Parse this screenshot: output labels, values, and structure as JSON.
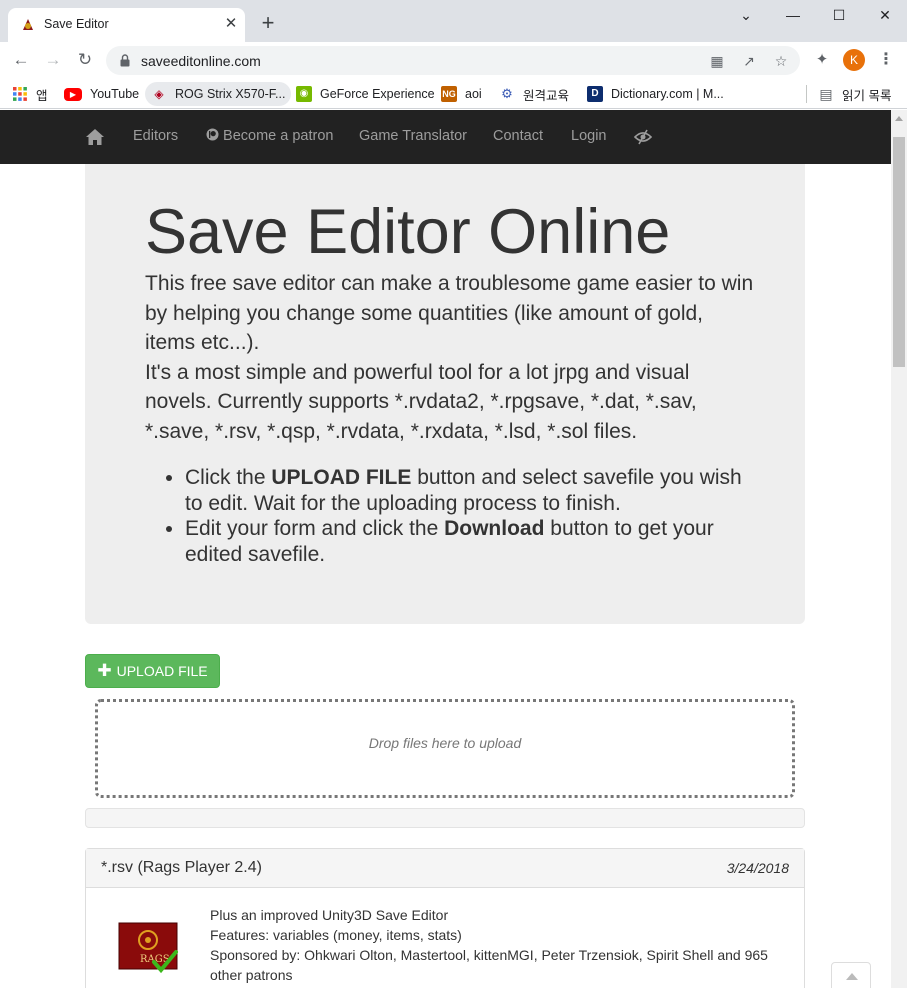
{
  "browser": {
    "tab_title": "Save Editor",
    "tab_close": "✕",
    "new_tab": "+",
    "window_controls": [
      "⌄",
      "—",
      "☐",
      "✕"
    ],
    "url": "saveeditonline.com",
    "avatar_letter": "K",
    "bookmarks": [
      {
        "label": "앱",
        "icon": "apps-grid-icon"
      },
      {
        "label": "YouTube",
        "icon": "youtube-icon",
        "color": "#ff0000"
      },
      {
        "label": "ROG Strix X570-F...",
        "icon": "rog-icon",
        "color": "#b0001e"
      },
      {
        "label": "GeForce Experience",
        "icon": "nvidia-icon",
        "color": "#76b900"
      },
      {
        "label": "aoi",
        "icon": "ng-icon",
        "color": "#c06000"
      },
      {
        "label": "원격교육",
        "icon": "globe-icon",
        "color": "#3b5bb5"
      },
      {
        "label": "Dictionary.com | M...",
        "icon": "dictionary-icon",
        "color": "#0d2d6e"
      },
      {
        "label": "읽기 목록",
        "icon": "reading-list-icon"
      }
    ]
  },
  "nav": {
    "links": [
      "Editors",
      "Become a patron",
      "Game Translator",
      "Contact",
      "Login"
    ]
  },
  "hero": {
    "title": "Save Editor Online",
    "intro_line1": "This free save editor can make a troublesome game easier to win by helping you change some quantities (like amount of gold, items etc...).",
    "intro_line2": "It's a most simple and powerful tool for a lot jrpg and visual novels. Currently supports *.rvdata2, *.rpgsave, *.dat, *.sav, *.save, *.rsv, *.qsp, *.rvdata, *.rxdata, *.lsd, *.sol files.",
    "steps": [
      {
        "before": "Click the ",
        "bold": "UPLOAD FILE",
        "after": " button and select savefile you wish to edit. Wait for the uploading process to finish."
      },
      {
        "before": "Edit your form and click the ",
        "bold": "Download",
        "after": " button to get your edited savefile."
      }
    ]
  },
  "upload": {
    "button_label": "UPLOAD FILE",
    "drop_text": "Drop files here to upload"
  },
  "entry": {
    "title": "*.rsv (Rags Player 2.4)",
    "date": "3/24/2018",
    "line1": "Plus an improved Unity3D Save Editor",
    "line2": "Features: variables (money, items, stats)",
    "line3": "Sponsored by: Ohkwari Olton, Mastertool, kittenMGI, Peter Trzensiok, Spirit Shell and 965 other patrons",
    "logo_text": "RAGS"
  }
}
